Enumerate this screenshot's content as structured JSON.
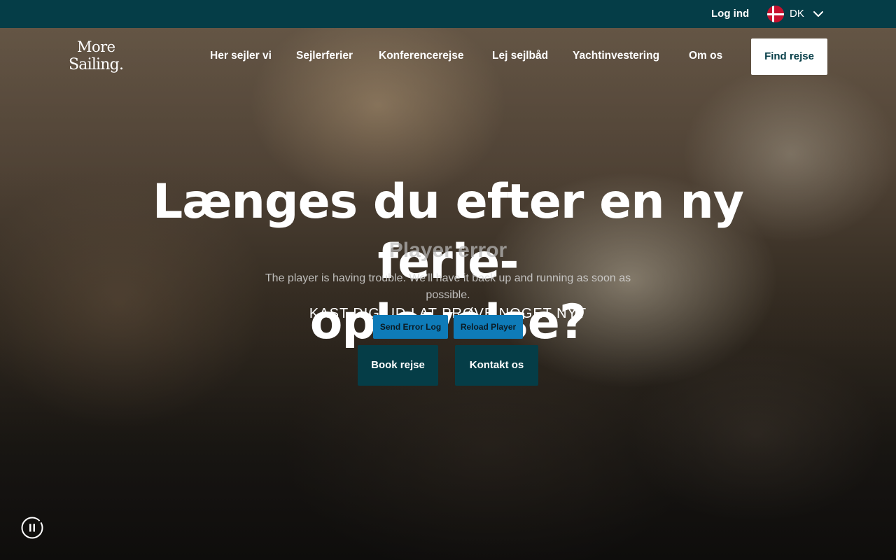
{
  "topbar": {
    "login_label": "Log ind",
    "language": {
      "flag_icon": "denmark-flag-icon",
      "label": "DK",
      "chevron_icon": "chevron-down-icon"
    }
  },
  "header": {
    "logo": {
      "line1": "More",
      "line2": "Sailing."
    },
    "nav": [
      {
        "label": "Her sejler vi"
      },
      {
        "label": "Sejlerferier"
      },
      {
        "label": "Konferencerejse"
      },
      {
        "label": "Lej sejlbåd"
      },
      {
        "label": "Yachtinvestering"
      },
      {
        "label": "Om os"
      }
    ],
    "cta_label": "Find rejse"
  },
  "hero": {
    "title_line1": "Længes du efter en ny ferie-",
    "title_line2": "oplevelse?",
    "subtitle": "KAST DIG UD I AT PRØVE NOGET NYT",
    "buttons": {
      "book": "Book rejse",
      "contact": "Kontakt os"
    }
  },
  "player_error": {
    "title": "Player error",
    "message_line1": "The player is having trouble. We'll have it back up and running as soon as",
    "message_line2": "possible.",
    "send_log_label": "Send Error Log",
    "reload_label": "Reload Player"
  },
  "video_controls": {
    "pause_icon": "pause-icon"
  },
  "colors": {
    "brand_dark_teal": "#053d47",
    "white": "#ffffff",
    "error_button_blue": "#0e7bb8"
  }
}
